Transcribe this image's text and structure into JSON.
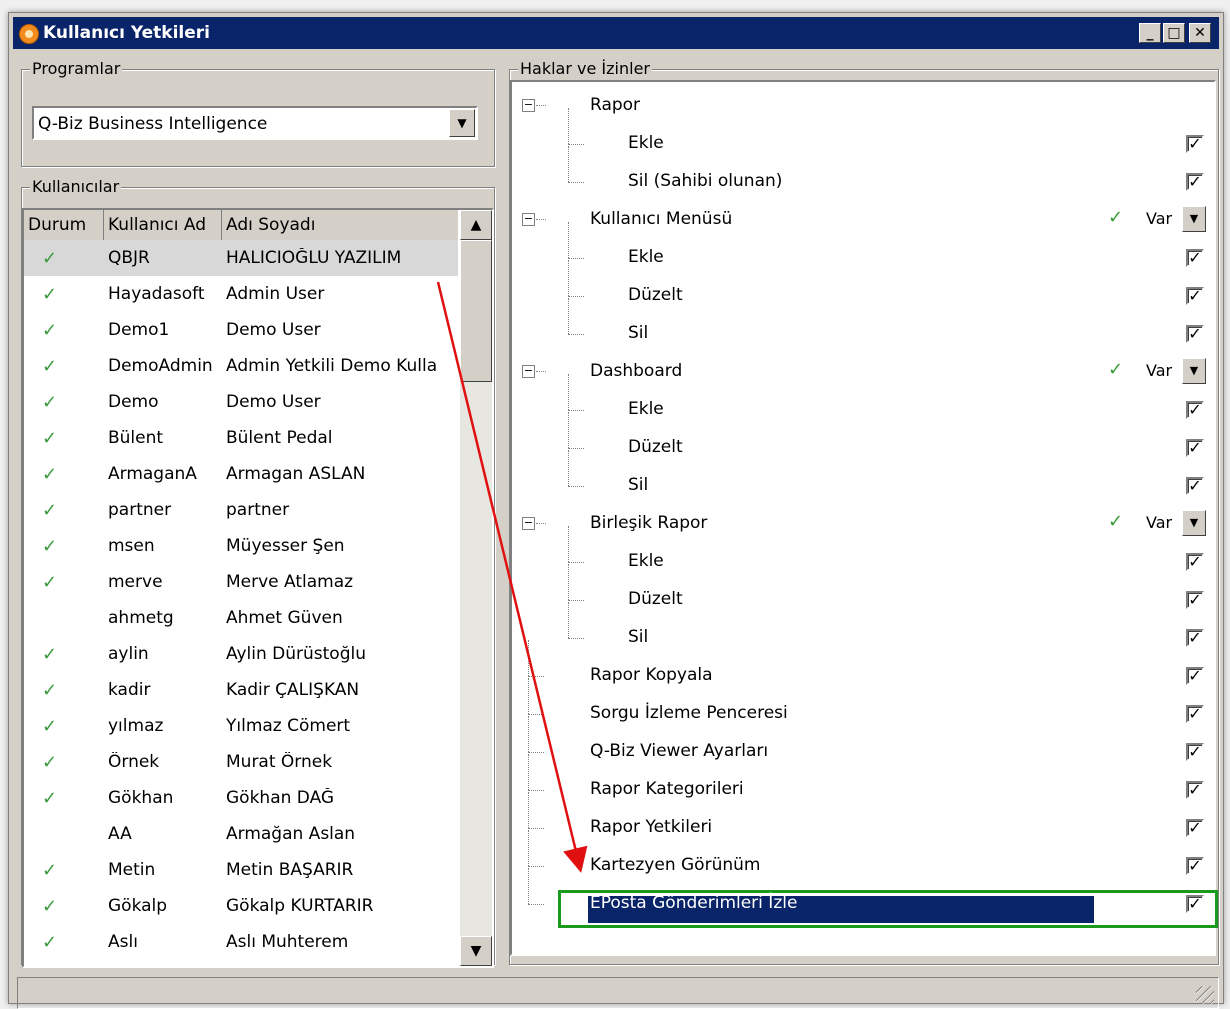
{
  "window": {
    "title": "Kullanıcı Yetkileri",
    "min": "_",
    "max": "□",
    "close": "✕"
  },
  "programs": {
    "group_label": "Programlar",
    "selected": "Q-Biz Business Intelligence"
  },
  "users": {
    "group_label": "Kullanıcılar",
    "columns": [
      "Durum",
      "Kullanıcı Ad",
      "Adı Soyadı"
    ],
    "rows": [
      {
        "status": "✓",
        "user": "QBJR",
        "name": "HALICIOĞLU YAZILIM"
      },
      {
        "status": "✓",
        "user": "Hayadasoft",
        "name": "Admin User"
      },
      {
        "status": "✓",
        "user": "Demo1",
        "name": "Demo User"
      },
      {
        "status": "✓",
        "user": "DemoAdmin",
        "name": "Admin Yetkili Demo Kulla"
      },
      {
        "status": "✓",
        "user": "Demo",
        "name": "Demo User"
      },
      {
        "status": "✓",
        "user": "Bülent",
        "name": "Bülent Pedal"
      },
      {
        "status": "✓",
        "user": "ArmaganA",
        "name": "Armagan ASLAN"
      },
      {
        "status": "✓",
        "user": "partner",
        "name": "partner"
      },
      {
        "status": "✓",
        "user": "msen",
        "name": "Müyesser Şen"
      },
      {
        "status": "✓",
        "user": "merve",
        "name": "Merve Atlamaz"
      },
      {
        "status": "",
        "user": "ahmetg",
        "name": "Ahmet Güven"
      },
      {
        "status": "✓",
        "user": "aylin",
        "name": "Aylin Dürüstoğlu"
      },
      {
        "status": "✓",
        "user": "kadir",
        "name": "Kadir ÇALIŞKAN"
      },
      {
        "status": "✓",
        "user": "yılmaz",
        "name": "Yılmaz Cömert"
      },
      {
        "status": "✓",
        "user": "Örnek",
        "name": "Murat Örnek"
      },
      {
        "status": "✓",
        "user": "Gökhan",
        "name": "Gökhan DAĞ"
      },
      {
        "status": "",
        "user": "AA",
        "name": "Armağan Aslan"
      },
      {
        "status": "✓",
        "user": "Metin",
        "name": "Metin BAŞARIR"
      },
      {
        "status": "✓",
        "user": "Gökalp",
        "name": "Gökalp KURTARIR"
      },
      {
        "status": "✓",
        "user": "Aslı",
        "name": "Aslı Muhterem"
      }
    ]
  },
  "rights": {
    "group_label": "Haklar ve İzinler",
    "var_label": "Var",
    "var_check": "✓",
    "nodes": [
      {
        "label": "Rapor",
        "level": 0,
        "expander": "−"
      },
      {
        "label": "Ekle",
        "level": 1,
        "checked": "✓"
      },
      {
        "label": "Sil (Sahibi olunan)",
        "level": 1,
        "checked": "✓"
      },
      {
        "label": "Kullanıcı Menüsü",
        "level": 0,
        "expander": "−",
        "var": true
      },
      {
        "label": "Ekle",
        "level": 1,
        "checked": "✓"
      },
      {
        "label": "Düzelt",
        "level": 1,
        "checked": "✓"
      },
      {
        "label": "Sil",
        "level": 1,
        "checked": "✓"
      },
      {
        "label": "Dashboard",
        "level": 0,
        "expander": "−",
        "var": true
      },
      {
        "label": "Ekle",
        "level": 1,
        "checked": "✓"
      },
      {
        "label": "Düzelt",
        "level": 1,
        "checked": "✓"
      },
      {
        "label": "Sil",
        "level": 1,
        "checked": "✓"
      },
      {
        "label": "Birleşik Rapor",
        "level": 0,
        "expander": "−",
        "var": true
      },
      {
        "label": "Ekle",
        "level": 1,
        "checked": "✓"
      },
      {
        "label": "Düzelt",
        "level": 1,
        "checked": "✓"
      },
      {
        "label": "Sil",
        "level": 1,
        "checked": "✓"
      },
      {
        "label": "Rapor Kopyala",
        "level": 0,
        "checked": "✓"
      },
      {
        "label": "Sorgu İzleme Penceresi",
        "level": 0,
        "checked": "✓"
      },
      {
        "label": "Q-Biz Viewer Ayarları",
        "level": 0,
        "checked": "✓"
      },
      {
        "label": "Rapor Kategorileri",
        "level": 0,
        "checked": "✓"
      },
      {
        "label": "Rapor Yetkileri",
        "level": 0,
        "checked": "✓"
      },
      {
        "label": "Kartezyen Görünüm",
        "level": 0,
        "checked": "✓"
      },
      {
        "label": "EPosta Gönderimleri İzle",
        "level": 0,
        "checked": "✓",
        "selected": true
      }
    ]
  },
  "colors": {
    "titlebar": "#0a246a",
    "check_green": "#3a9a3a",
    "annotation_arrow": "#e01010",
    "highlight_box": "#1a9a1a"
  }
}
